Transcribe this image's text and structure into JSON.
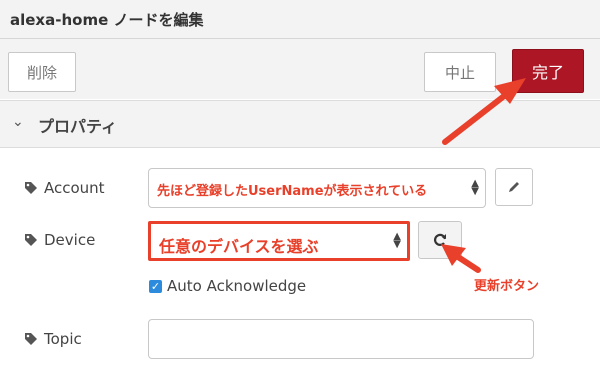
{
  "dialog": {
    "title": "alexa-home ノードを編集"
  },
  "toolbar": {
    "delete_label": "削除",
    "cancel_label": "中止",
    "done_label": "完了"
  },
  "section": {
    "label": "プロパティ"
  },
  "form": {
    "account_label": "Account",
    "account_value": "先ほど登録したUserNameが表示されている",
    "device_label": "Device",
    "device_value": "任意のデバイスを選ぶ",
    "auto_ack_label": "Auto Acknowledge",
    "auto_ack_checked": true,
    "topic_label": "Topic",
    "topic_value": ""
  },
  "annotations": {
    "refresh_note": "更新ボタン"
  },
  "colors": {
    "accent": "#ad1625",
    "annotation": "#e8402a",
    "checkbox": "#2d8bdd"
  },
  "icons": [
    "tag-icon",
    "pencil-icon",
    "refresh-icon",
    "chevron-down-icon",
    "checkmark-icon",
    "arrow-annotation"
  ]
}
